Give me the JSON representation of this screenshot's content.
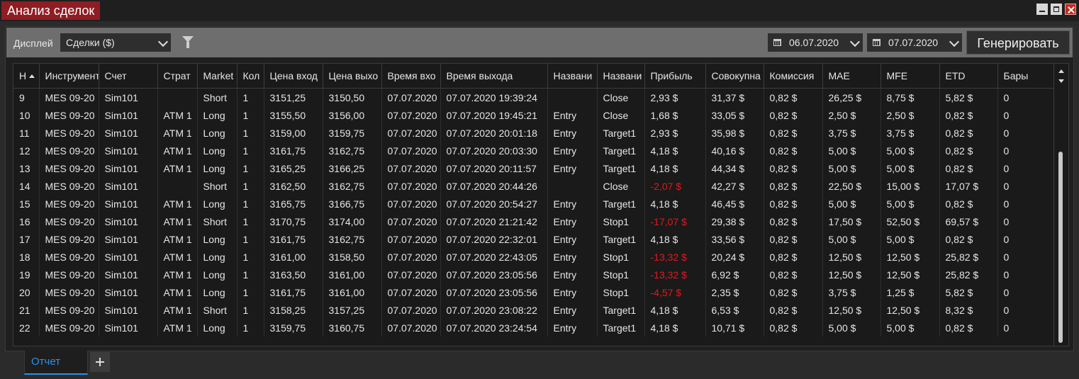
{
  "window": {
    "title": "Анализ сделок"
  },
  "toolbar": {
    "display_label": "Дисплей",
    "display_value": "Сделки ($)",
    "date_from": "06.07.2020",
    "date_to": "07.07.2020",
    "generate_label": "Генерировать"
  },
  "grid": {
    "columns": [
      "Н",
      "Инструмент",
      "Счет",
      "Страт",
      "Market",
      "Кол",
      "Цена вход",
      "Цена выхо",
      "Время вхо",
      "Время выхода",
      "Названи",
      "Названи",
      "Прибыль",
      "Совокупна",
      "Комиссия",
      "MAE",
      "MFE",
      "ETD",
      "Бары"
    ],
    "rows": [
      [
        "9",
        "MES 09-20",
        "Sim101",
        "",
        "Short",
        "1",
        "3151,25",
        "3150,50",
        "07.07.2020",
        "07.07.2020 19:39:24",
        "",
        "Close",
        "2,93 $",
        "31,37 $",
        "0,82 $",
        "26,25 $",
        "8,75 $",
        "5,82 $",
        "0"
      ],
      [
        "10",
        "MES 09-20",
        "Sim101",
        "ATM 1",
        "Long",
        "1",
        "3155,50",
        "3156,00",
        "07.07.2020",
        "07.07.2020 19:45:21",
        "Entry",
        "Close",
        "1,68 $",
        "33,05 $",
        "0,82 $",
        "2,50 $",
        "2,50 $",
        "0,82 $",
        "0"
      ],
      [
        "11",
        "MES 09-20",
        "Sim101",
        "ATM 1",
        "Long",
        "1",
        "3159,00",
        "3159,75",
        "07.07.2020",
        "07.07.2020 20:01:18",
        "Entry",
        "Target1",
        "2,93 $",
        "35,98 $",
        "0,82 $",
        "3,75 $",
        "3,75 $",
        "0,82 $",
        "0"
      ],
      [
        "12",
        "MES 09-20",
        "Sim101",
        "ATM 1",
        "Long",
        "1",
        "3161,75",
        "3162,75",
        "07.07.2020",
        "07.07.2020 20:03:30",
        "Entry",
        "Target1",
        "4,18 $",
        "40,16 $",
        "0,82 $",
        "5,00 $",
        "5,00 $",
        "0,82 $",
        "0"
      ],
      [
        "13",
        "MES 09-20",
        "Sim101",
        "ATM 1",
        "Long",
        "1",
        "3165,25",
        "3166,25",
        "07.07.2020",
        "07.07.2020 20:11:57",
        "Entry",
        "Target1",
        "4,18 $",
        "44,34 $",
        "0,82 $",
        "5,00 $",
        "5,00 $",
        "0,82 $",
        "0"
      ],
      [
        "14",
        "MES 09-20",
        "Sim101",
        "",
        "Short",
        "1",
        "3162,50",
        "3162,75",
        "07.07.2020",
        "07.07.2020 20:44:26",
        "",
        "Close",
        "-2,07 $",
        "42,27 $",
        "0,82 $",
        "22,50 $",
        "15,00 $",
        "17,07 $",
        "0"
      ],
      [
        "15",
        "MES 09-20",
        "Sim101",
        "ATM 1",
        "Long",
        "1",
        "3165,75",
        "3166,75",
        "07.07.2020",
        "07.07.2020 20:54:27",
        "Entry",
        "Target1",
        "4,18 $",
        "46,45 $",
        "0,82 $",
        "5,00 $",
        "5,00 $",
        "0,82 $",
        "0"
      ],
      [
        "16",
        "MES 09-20",
        "Sim101",
        "ATM 1",
        "Short",
        "1",
        "3170,75",
        "3174,00",
        "07.07.2020",
        "07.07.2020 21:21:42",
        "Entry",
        "Stop1",
        "-17,07 $",
        "29,38 $",
        "0,82 $",
        "17,50 $",
        "52,50 $",
        "69,57 $",
        "0"
      ],
      [
        "17",
        "MES 09-20",
        "Sim101",
        "ATM 1",
        "Long",
        "1",
        "3161,75",
        "3162,75",
        "07.07.2020",
        "07.07.2020 22:32:01",
        "Entry",
        "Target1",
        "4,18 $",
        "33,56 $",
        "0,82 $",
        "5,00 $",
        "5,00 $",
        "0,82 $",
        "0"
      ],
      [
        "18",
        "MES 09-20",
        "Sim101",
        "ATM 1",
        "Long",
        "1",
        "3161,00",
        "3158,50",
        "07.07.2020",
        "07.07.2020 22:43:05",
        "Entry",
        "Stop1",
        "-13,32 $",
        "20,24 $",
        "0,82 $",
        "12,50 $",
        "12,50 $",
        "25,82 $",
        "0"
      ],
      [
        "19",
        "MES 09-20",
        "Sim101",
        "ATM 1",
        "Long",
        "1",
        "3163,50",
        "3161,00",
        "07.07.2020",
        "07.07.2020 23:05:56",
        "Entry",
        "Stop1",
        "-13,32 $",
        "6,92 $",
        "0,82 $",
        "12,50 $",
        "12,50 $",
        "25,82 $",
        "0"
      ],
      [
        "20",
        "MES 09-20",
        "Sim101",
        "ATM 1",
        "Long",
        "1",
        "3161,75",
        "3161,00",
        "07.07.2020",
        "07.07.2020 23:05:56",
        "Entry",
        "Stop1",
        "-4,57 $",
        "2,35 $",
        "0,82 $",
        "3,75 $",
        "1,25 $",
        "5,82 $",
        "0"
      ],
      [
        "21",
        "MES 09-20",
        "Sim101",
        "ATM 1",
        "Short",
        "1",
        "3158,25",
        "3157,25",
        "07.07.2020",
        "07.07.2020 23:08:22",
        "Entry",
        "Target1",
        "4,18 $",
        "6,53 $",
        "0,82 $",
        "12,50 $",
        "12,50 $",
        "8,32 $",
        "0"
      ],
      [
        "22",
        "MES 09-20",
        "Sim101",
        "ATM 1",
        "Long",
        "1",
        "3159,75",
        "3160,75",
        "07.07.2020",
        "07.07.2020 23:24:54",
        "Entry",
        "Target1",
        "4,18 $",
        "10,71 $",
        "0,82 $",
        "5,00 $",
        "5,00 $",
        "0,82 $",
        "0"
      ]
    ]
  },
  "tabs": {
    "report_label": "Отчет"
  },
  "colors": {
    "title_tab": "#8f1d24",
    "negative": "#e0191f",
    "active_tab": "#2f8fe8"
  }
}
